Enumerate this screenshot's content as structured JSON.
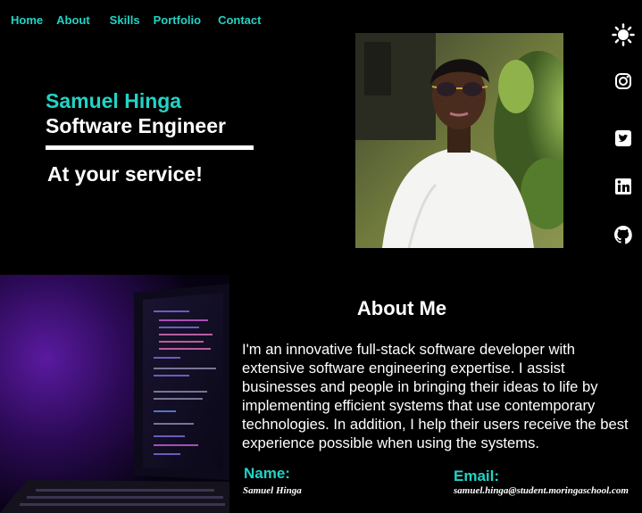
{
  "nav": {
    "items": [
      {
        "label": "Home"
      },
      {
        "label": "About"
      },
      {
        "label": "Skills"
      },
      {
        "label": "Portfolio"
      },
      {
        "label": "Contact"
      }
    ]
  },
  "hero": {
    "name": "Samuel Hinga",
    "role": "Software Engineer",
    "tagline": "At your service!"
  },
  "socials": [
    "sun-icon",
    "instagram-icon",
    "twitter-icon",
    "linkedin-icon",
    "github-icon"
  ],
  "about": {
    "title": "About Me",
    "body": "I'm an innovative full-stack software developer with extensive software engineering expertise. I assist businesses and people in bringing their ideas to life by implementing efficient systems that use contemporary technologies. In addition, I help their users receive the best experience possible when using the systems.",
    "name_label": "Name:",
    "name_value": "Samuel Hinga",
    "email_label": "Email:",
    "email_value": "samuel.hinga@student.moringaschool.com"
  },
  "colors": {
    "accent": "#22d3c5",
    "background": "#000000",
    "text": "#ffffff"
  }
}
